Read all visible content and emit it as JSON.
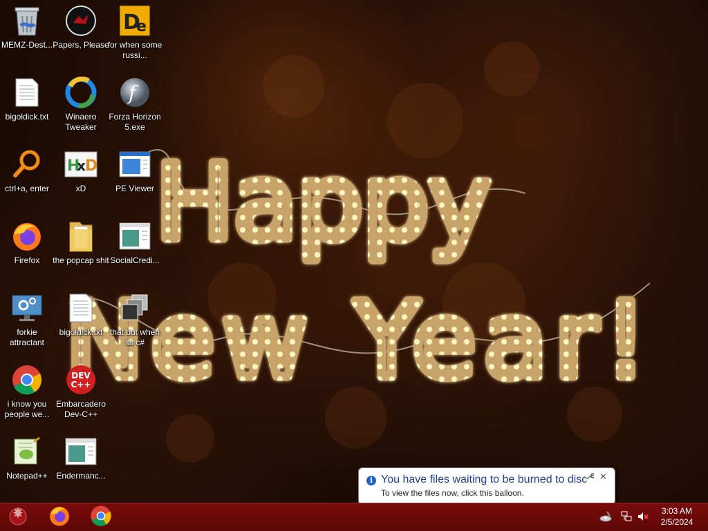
{
  "desktop": {
    "icons": [
      {
        "label": "MEMZ-Dest...",
        "icon": "recycle-bin-icon"
      },
      {
        "label": "Papers, Please",
        "icon": "papers-please-icon"
      },
      {
        "label": "for when some russi...",
        "icon": "de-app-icon"
      },
      {
        "label": "bigoldick.txt",
        "icon": "text-file-icon"
      },
      {
        "label": "Winaero Tweaker",
        "icon": "winaero-tweaker-icon"
      },
      {
        "label": "Forza Horizon 5.exe",
        "icon": "flash-icon"
      },
      {
        "label": "ctrl+a, enter",
        "icon": "magnifier-icon"
      },
      {
        "label": "xD",
        "icon": "hxd-icon"
      },
      {
        "label": "PE Viewer",
        "icon": "pe-viewer-icon"
      },
      {
        "label": "Firefox",
        "icon": "firefox-icon"
      },
      {
        "label": "the popcap shit",
        "icon": "folder-icon"
      },
      {
        "label": "SocialCredi...",
        "icon": "app-window-icon"
      },
      {
        "label": "forkie attractant",
        "icon": "monitor-gear-icon"
      },
      {
        "label": "bigoldick.txt",
        "icon": "text-file-icon"
      },
      {
        "label": "that but when its c#",
        "icon": "stacked-windows-icon"
      },
      {
        "label": "i know you people we...",
        "icon": "chrome-icon"
      },
      {
        "label": "Embarcadero Dev-C++",
        "icon": "devcpp-icon"
      },
      {
        "label": "Notepad++",
        "icon": "notepadpp-icon"
      },
      {
        "label": "Endermanc...",
        "icon": "app-window-icon"
      }
    ]
  },
  "wallpaper": {
    "line1": "Happy",
    "line2": "New Year!"
  },
  "balloon": {
    "title": "You have files waiting to be burned to disc",
    "text": "To view the files now, click this balloon.",
    "info_glyph": "i",
    "close_glyph": "×",
    "options_glyph": "🔧"
  },
  "taskbar": {
    "pinned": [
      {
        "icon": "start-orb-icon"
      },
      {
        "icon": "firefox-icon"
      },
      {
        "icon": "chrome-icon"
      }
    ],
    "tray": [
      {
        "icon": "disc-burn-icon"
      },
      {
        "icon": "network-icon"
      },
      {
        "icon": "volume-muted-icon"
      }
    ],
    "time": "3:03 AM",
    "date": "2/5/2024"
  },
  "colors": {
    "taskbar": "#6b0a0a",
    "balloon_title": "#1f3e9a",
    "lights": "#ffd777"
  }
}
